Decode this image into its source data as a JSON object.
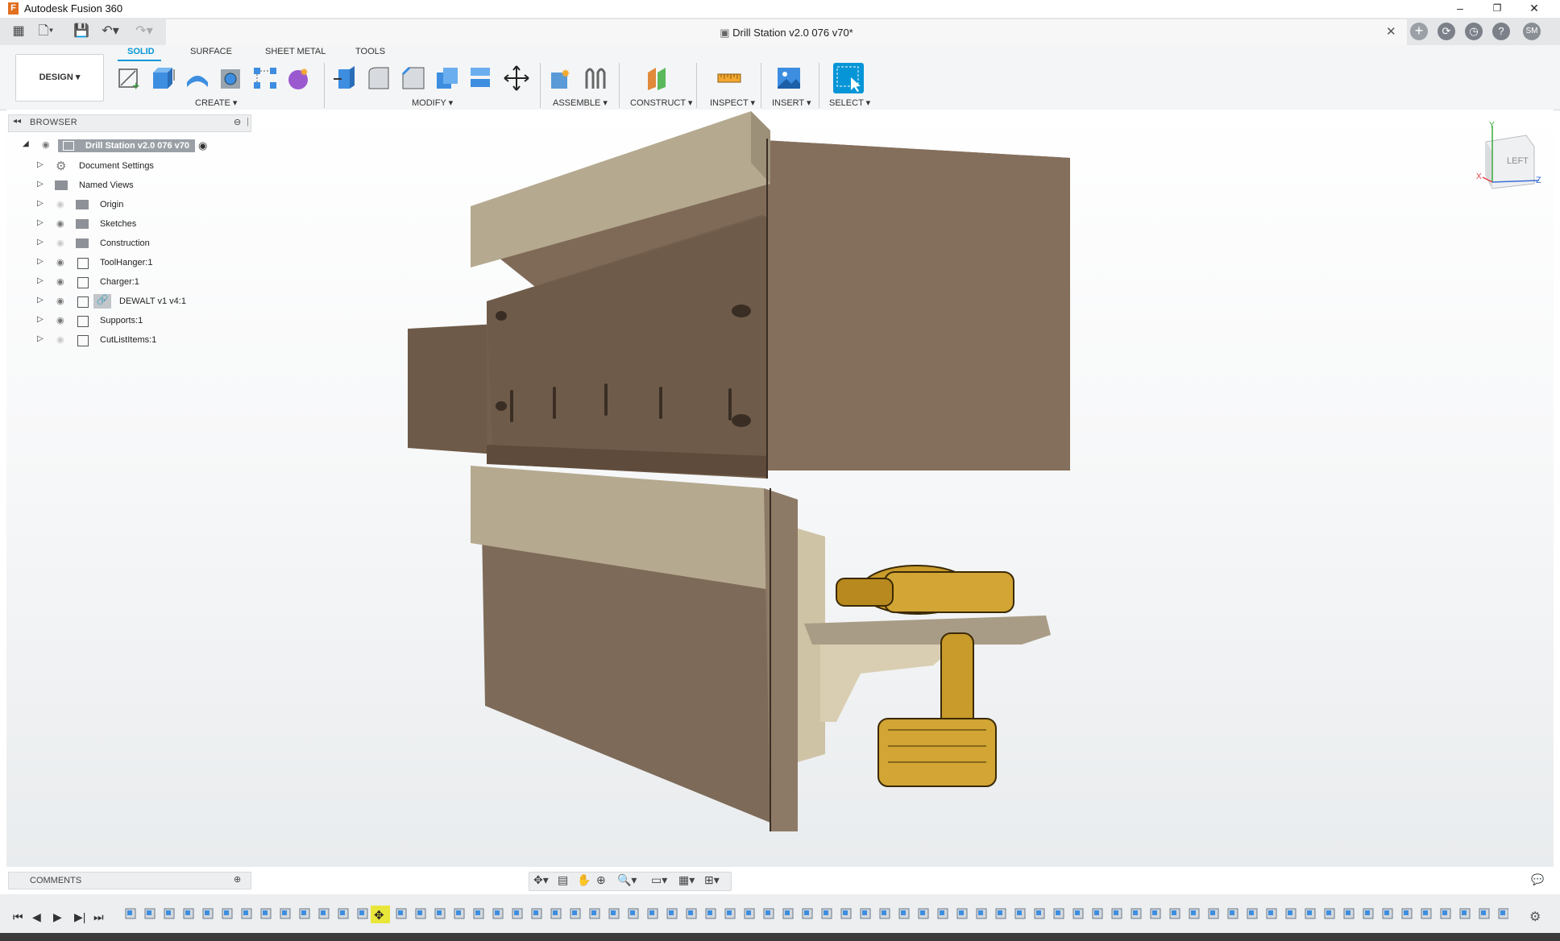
{
  "app": {
    "title": "Autodesk Fusion 360",
    "logo_letter": "F"
  },
  "window": {
    "minimize": "–",
    "restore": "❐",
    "close": "✕"
  },
  "document": {
    "tab_title": "Drill Station v2.0 076 v70*",
    "close": "✕"
  },
  "user": {
    "initials": "SM"
  },
  "workspace": {
    "label": "DESIGN ▾"
  },
  "tabs": [
    {
      "label": "SOLID"
    },
    {
      "label": "SURFACE"
    },
    {
      "label": "SHEET METAL"
    },
    {
      "label": "TOOLS"
    }
  ],
  "groups": {
    "create": "CREATE ▾",
    "modify": "MODIFY ▾",
    "assemble": "ASSEMBLE ▾",
    "construct": "CONSTRUCT ▾",
    "inspect": "INSPECT ▾",
    "insert": "INSERT ▾",
    "select": "SELECT ▾"
  },
  "browser": {
    "label": "BROWSER",
    "root": "Drill Station v2.0 076 v70",
    "items": [
      {
        "label": "Document Settings"
      },
      {
        "label": "Named Views"
      },
      {
        "label": "Origin"
      },
      {
        "label": "Sketches"
      },
      {
        "label": "Construction"
      },
      {
        "label": "ToolHanger:1"
      },
      {
        "label": "Charger:1"
      },
      {
        "label": "DEWALT v1 v4:1"
      },
      {
        "label": "Supports:1"
      },
      {
        "label": "CutListItems:1"
      }
    ]
  },
  "viewcube": {
    "face": "LEFT",
    "axis_x": "X",
    "axis_y": "Y",
    "axis_z": "Z"
  },
  "comments": {
    "label": "COMMENTS"
  },
  "colors": {
    "accent": "#0696d7",
    "wood_dark": "#7a6552",
    "wood_light": "#b3a88e",
    "drill": "#c89b2a"
  }
}
